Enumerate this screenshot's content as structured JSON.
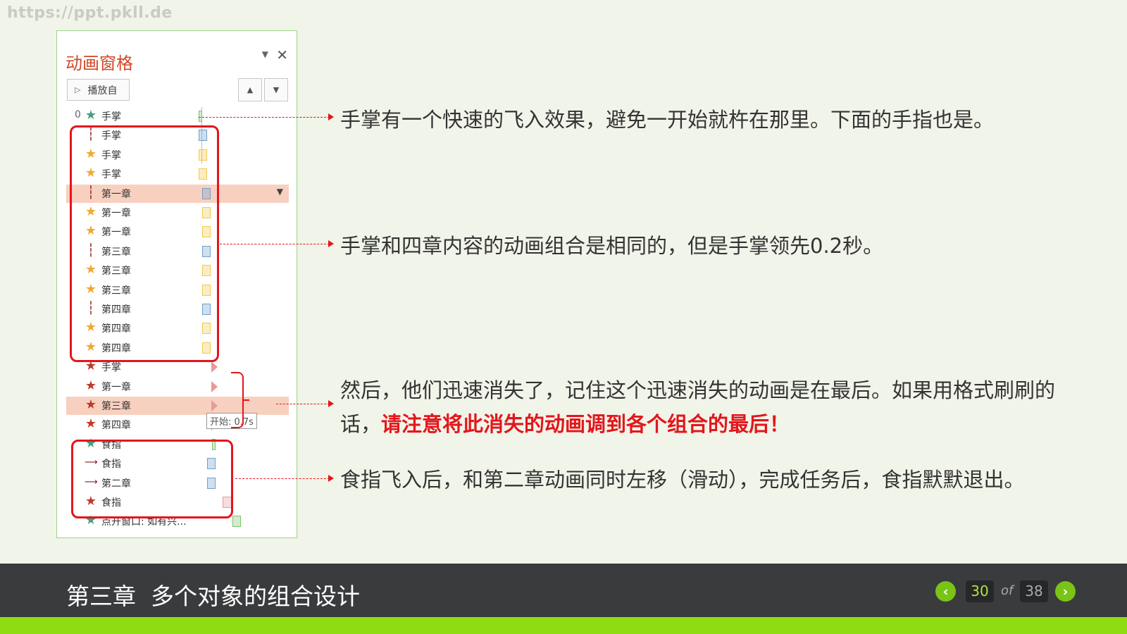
{
  "watermark": "https://ppt.pkll.de",
  "pane": {
    "title": "动画窗格",
    "menu_icon": "chevron-down-icon",
    "close": "✕",
    "play_label": "播放自",
    "rows": [
      {
        "num": "0",
        "icon": "star-green",
        "label": "手掌",
        "bar_color": "#7cc36b",
        "bar": "green-tick"
      },
      {
        "num": "",
        "icon": "path",
        "label": "手掌",
        "bar_color": "#6fa0cc",
        "bar": "blue"
      },
      {
        "num": "",
        "icon": "star-gold",
        "label": "手掌",
        "bar_color": "#f3c94b",
        "bar": "yellow"
      },
      {
        "num": "",
        "icon": "star-gold",
        "label": "手掌",
        "bar_color": "#f3c94b",
        "bar": "yellow"
      },
      {
        "num": "",
        "icon": "path",
        "label": "第一章",
        "bar_color": "#6fa0cc",
        "bar": "blue",
        "selected": true
      },
      {
        "num": "",
        "icon": "star-gold",
        "label": "第一章",
        "bar_color": "#f3c94b",
        "bar": "yellow"
      },
      {
        "num": "",
        "icon": "star-gold",
        "label": "第一章",
        "bar_color": "#f3c94b",
        "bar": "yellow"
      },
      {
        "num": "",
        "icon": "path",
        "label": "第三章",
        "bar_color": "#6fa0cc",
        "bar": "blue"
      },
      {
        "num": "",
        "icon": "star-gold",
        "label": "第三章",
        "bar_color": "#f3c94b",
        "bar": "yellow"
      },
      {
        "num": "",
        "icon": "star-gold",
        "label": "第三章",
        "bar_color": "#f3c94b",
        "bar": "yellow"
      },
      {
        "num": "",
        "icon": "path",
        "label": "第四章",
        "bar_color": "#6fa0cc",
        "bar": "blue"
      },
      {
        "num": "",
        "icon": "star-gold",
        "label": "第四章",
        "bar_color": "#f3c94b",
        "bar": "yellow"
      },
      {
        "num": "",
        "icon": "star-gold",
        "label": "第四章",
        "bar_color": "#f3c94b",
        "bar": "yellow"
      },
      {
        "num": "",
        "icon": "star-red",
        "label": "手掌",
        "bar_color": "#e79a9a",
        "bar": "exit"
      },
      {
        "num": "",
        "icon": "star-red",
        "label": "第一章",
        "bar_color": "#e79a9a",
        "bar": "exit"
      },
      {
        "num": "",
        "icon": "star-red",
        "label": "第三章",
        "bar_color": "#e79a9a",
        "bar": "exit",
        "selected": true
      },
      {
        "num": "",
        "icon": "star-red",
        "label": "第四章",
        "bar_color": "#e79a9a",
        "bar": "exit"
      },
      {
        "num": "",
        "icon": "star-green",
        "label": "食指",
        "bar_color": "#7cc36b",
        "bar": "green-tick"
      },
      {
        "num": "",
        "icon": "line",
        "label": "食指",
        "bar_color": "#6fa0cc",
        "bar": "blue"
      },
      {
        "num": "",
        "icon": "line",
        "label": "第二章",
        "bar_color": "#6fa0cc",
        "bar": "blue"
      },
      {
        "num": "",
        "icon": "star-red",
        "label": "食指",
        "bar_color": "#e79a9a",
        "bar": "pink"
      },
      {
        "num": "",
        "icon": "star-green",
        "label": "点开窗口: 如有兴...",
        "bar_color": "#7cc36b",
        "bar": "green"
      }
    ],
    "tooltip": "开始: 0.7s"
  },
  "notes": [
    {
      "text": "手掌有一个快速的飞入效果，避免一开始就杵在那里。下面的手指也是。"
    },
    {
      "text": "手掌和四章内容的动画组合是相同的，但是手掌领先0.2秒。"
    },
    {
      "text": "然后，他们迅速消失了，记住这个迅速消失的动画是在最后。如果用格式刷刷的话，",
      "highlight": "请注意将此消失的动画调到各个组合的最后！"
    },
    {
      "text": "食指飞入后，和第二章动画同时左移（滑动），完成任务后，食指默默退出。"
    }
  ],
  "footer": {
    "chapter": "第三章  多个对象的组合设计",
    "current_page": "30",
    "of": "of",
    "total_pages": "38",
    "prev_icon": "chevron-left-icon",
    "next_icon": "chevron-right-icon"
  },
  "colors": {
    "accent_red": "#e3161c",
    "brand_green": "#8fdc12",
    "pane_title": "#d24726"
  }
}
